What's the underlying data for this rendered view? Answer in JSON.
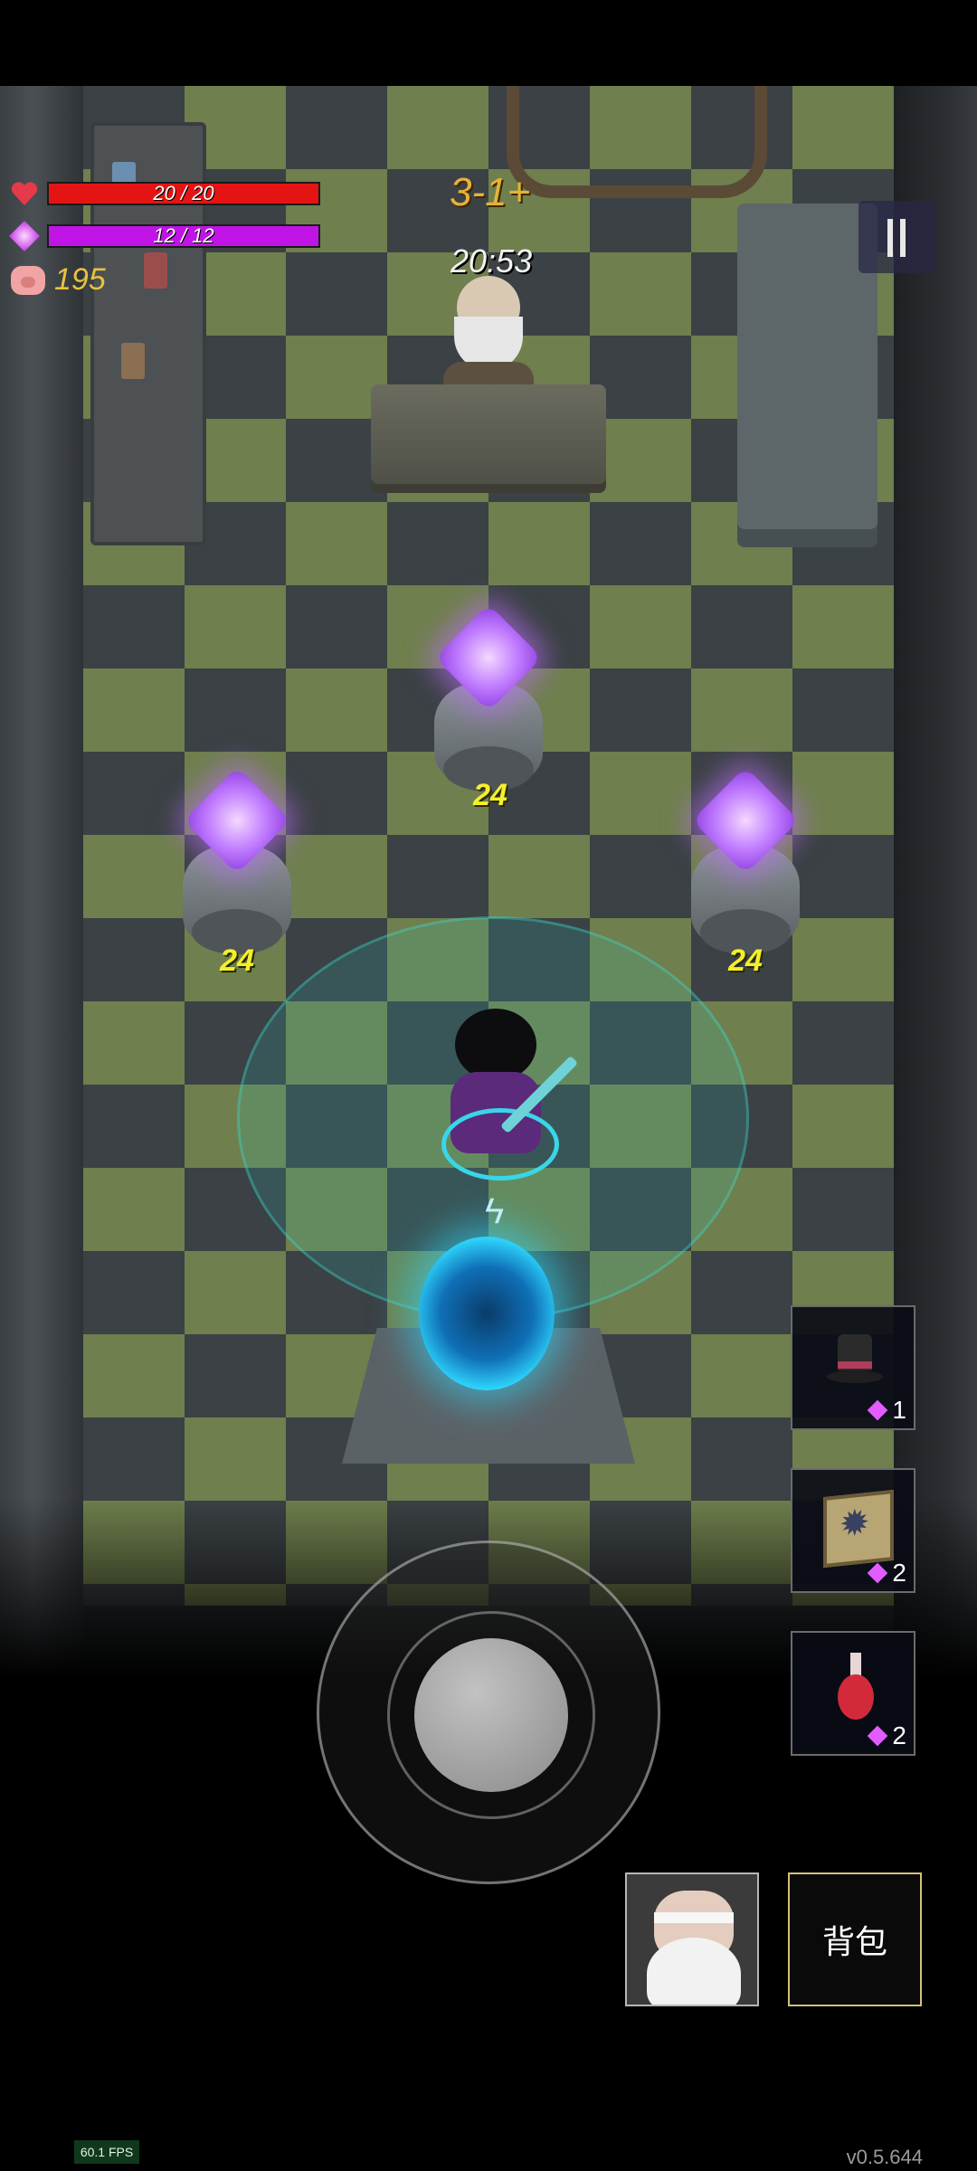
{
  "hud": {
    "hp": "20 / 20",
    "hp_fraction": 1.0,
    "mp": "12 / 12",
    "mp_fraction": 1.0,
    "coins": "195",
    "level": "3-1+",
    "timer": "20:53",
    "hp_color": "#e41414",
    "mp_color": "#c014e6"
  },
  "shop_items": [
    {
      "price": "24"
    },
    {
      "price": "24"
    },
    {
      "price": "24"
    }
  ],
  "inventory_slots": [
    {
      "icon": "top-hat-icon",
      "count": "1"
    },
    {
      "icon": "rune-box-icon",
      "count": "2"
    },
    {
      "icon": "red-potion-icon",
      "count": "2"
    }
  ],
  "bag_label": "背包",
  "fps": "60.1 FPS",
  "version": "v0.5.644"
}
